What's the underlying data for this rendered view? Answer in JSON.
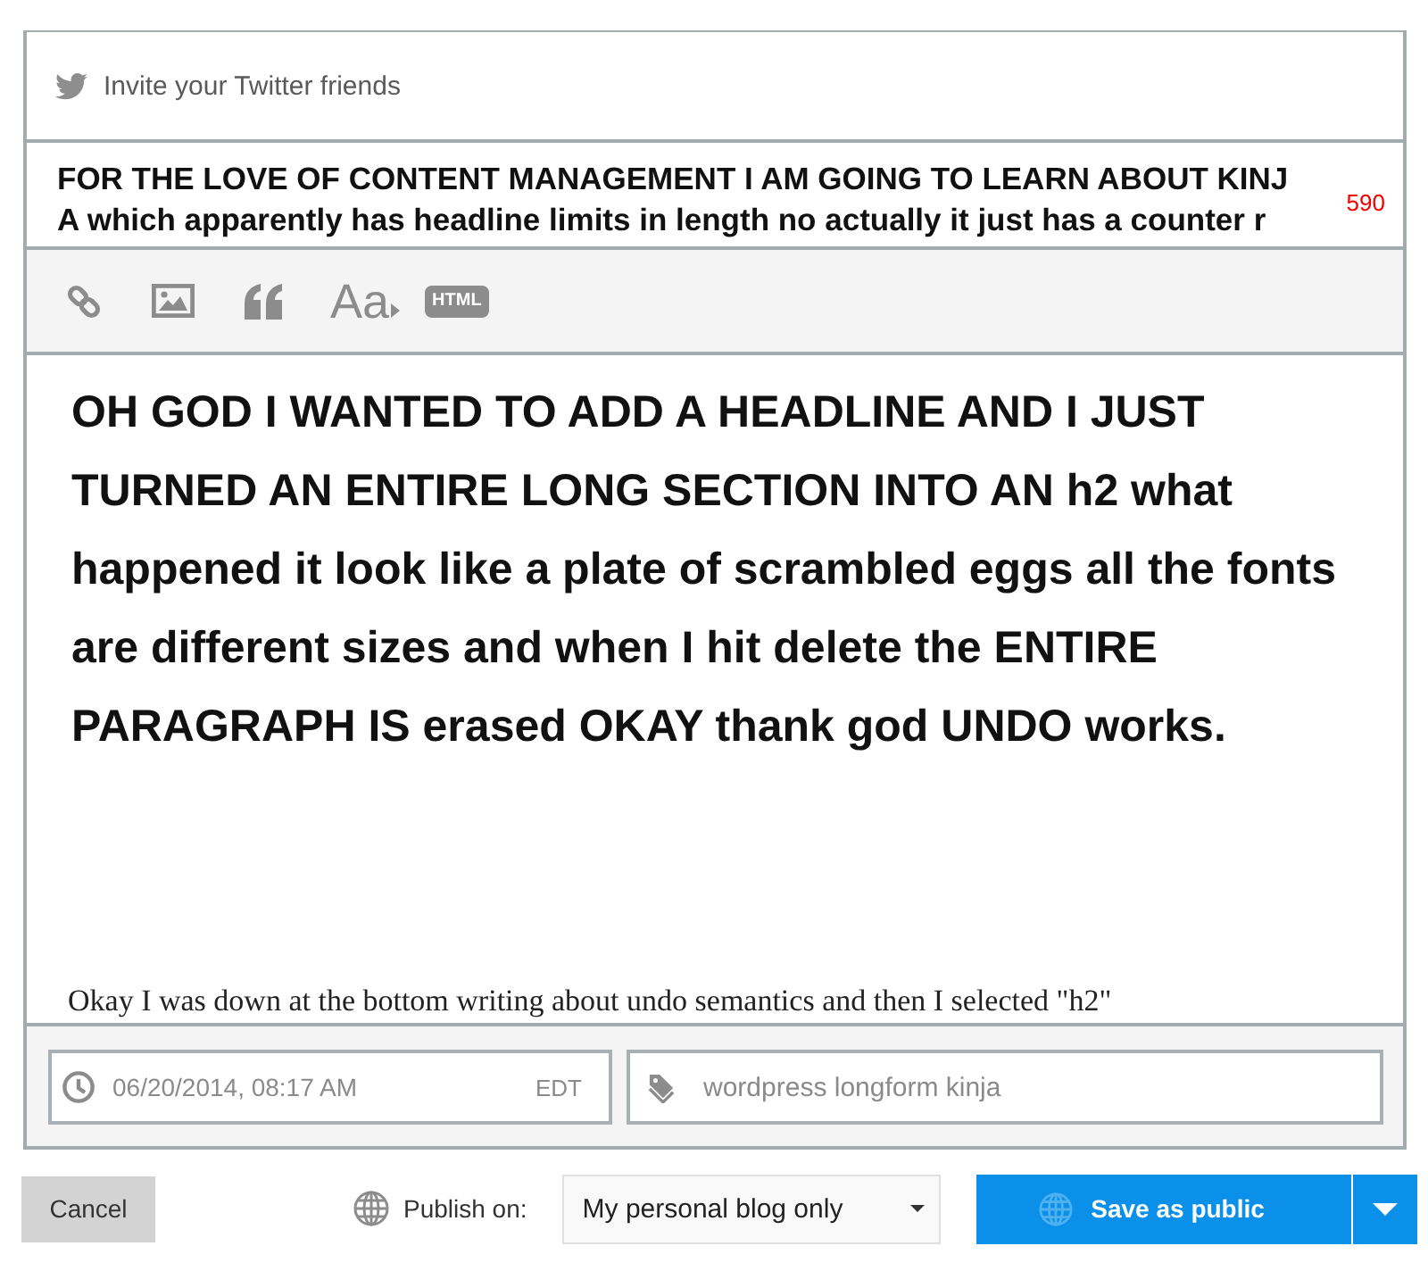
{
  "invite": {
    "label": "Invite your Twitter friends"
  },
  "headline": {
    "lines": [
      "FOR THE LOVE OF CONTENT MANAGEMENT I AM GOING TO LEARN ABOUT KINJ",
      "A which apparently has headline limits in length no actually it just has a counter r"
    ],
    "counter": "590"
  },
  "toolbar": [
    {
      "kind": "link"
    },
    {
      "kind": "image"
    },
    {
      "kind": "quote"
    },
    {
      "kind": "format",
      "label": "Aa"
    },
    {
      "kind": "html",
      "label": "HTML"
    }
  ],
  "body": [
    {
      "kind": "heading",
      "text": "OH GOD I WANTED TO ADD A HEADLINE AND I JUST TURNED AN ENTIRE LONG SECTION INTO AN h2 what happened it look like a plate of scrambled eggs all the fonts are different sizes and when I hit delete the ENTIRE PARAGRAPH IS erased OKAY thank god UNDO works."
    },
    {
      "kind": "paragraph",
      "text": "Okay I was down at the bottom writing about undo semantics and then I selected \"h2\""
    }
  ],
  "footer": {
    "date": {
      "value": "06/20/2014, 08:17 AM",
      "timezone": "EDT"
    },
    "tags": {
      "value": "wordpress longform kinja"
    }
  },
  "actions": {
    "cancel": "Cancel",
    "publish_label": "Publish on:",
    "destination": "My personal blog only",
    "save": "Save as public"
  }
}
